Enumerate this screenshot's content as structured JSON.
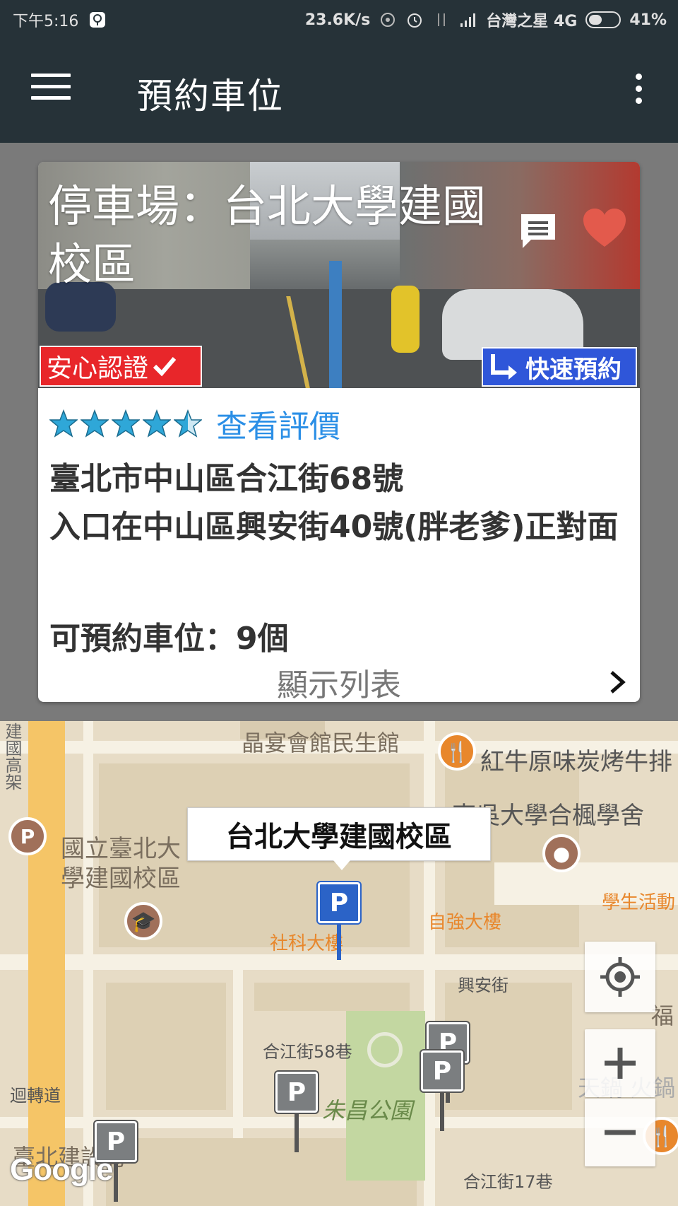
{
  "status_bar": {
    "time": "下午5:16",
    "speed": "23.6K/s",
    "carrier": "台灣之星 4G",
    "battery": "41%"
  },
  "app_bar": {
    "title": "預約車位"
  },
  "card": {
    "title": "停車場：台北大學建國校區",
    "badge_safe": "安心認證",
    "badge_fast": "快速預約",
    "rating": 4.5,
    "reviews_link": "查看評價",
    "address": "臺北市中山區合江街68號",
    "entrance": "入口在中山區興安街40號(胖老爹)正對面",
    "slots_label": "可預約車位：",
    "slots_value": "9個",
    "show_list": "顯示列表"
  },
  "map": {
    "callout": "台北大學建國校區",
    "labels": {
      "jingyan": "晶宴會館民生館",
      "hongniu": "紅牛原味炭烤牛排",
      "dongwu": "東吳大學合楓學舍",
      "ntpu": "國立臺北大學建國校區",
      "student": "學生活動",
      "ziqiang": "自強大樓",
      "sheke": "社科大樓",
      "xingan": "興安街",
      "hejiang58": "合江街58巷",
      "zhuchang": "朱昌公園",
      "hejiang17": "合江街17巷",
      "huizhuan": "迴轉道",
      "jiangou": "臺北建設局",
      "jianguo": "建國高架",
      "tiandu": "天鍋 火鍋",
      "fu": "福"
    },
    "google": "Google",
    "pin_letter": "P"
  },
  "colors": {
    "app_bar": "#263238",
    "star": "#2fa7d8",
    "link": "#2b8fe6",
    "badge_safe": "#e8262a",
    "badge_fast": "#2f56d9",
    "heart": "#e35a4c",
    "pin_active": "#2b63c7"
  }
}
